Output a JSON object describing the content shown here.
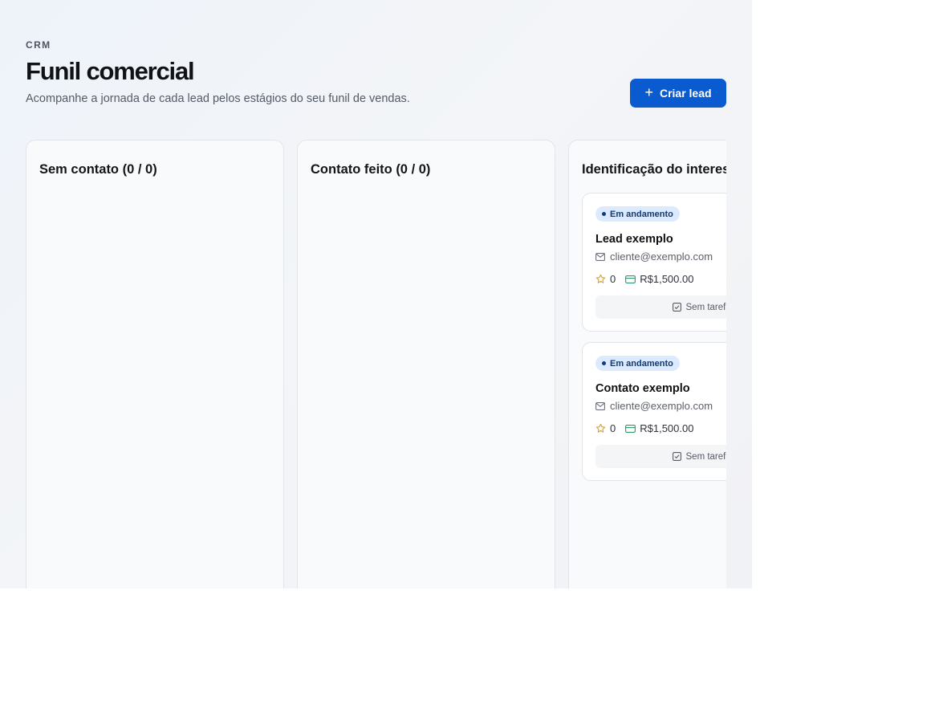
{
  "header": {
    "eyebrow": "CRM",
    "title": "Funil comercial",
    "subtitle": "Acompanhe a jornada de cada lead pelos estágios do seu funil de vendas.",
    "create_button_label": "Criar lead"
  },
  "columns": [
    {
      "title": "Sem contato (0 / 0)"
    },
    {
      "title": "Contato feito (0 / 0)"
    },
    {
      "title": "Identificação do interesse"
    }
  ],
  "cards": [
    {
      "status": "Em andamento",
      "name": "Lead exemplo",
      "email": "cliente@exemplo.com",
      "rating": "0",
      "value": "R$1,500.00",
      "tasks": "Sem tarefas"
    },
    {
      "status": "Em andamento",
      "name": "Contato exemplo",
      "email": "cliente@exemplo.com",
      "rating": "0",
      "value": "R$1,500.00",
      "tasks": "Sem tarefas"
    }
  ],
  "colors": {
    "primary": "#0a5bd0",
    "badge_bg": "#dbeafe",
    "star": "#e0a020",
    "money": "#2e9a6a"
  },
  "icons": [
    "plus-icon",
    "mail-icon",
    "star-icon",
    "money-icon",
    "checkbox-icon"
  ]
}
